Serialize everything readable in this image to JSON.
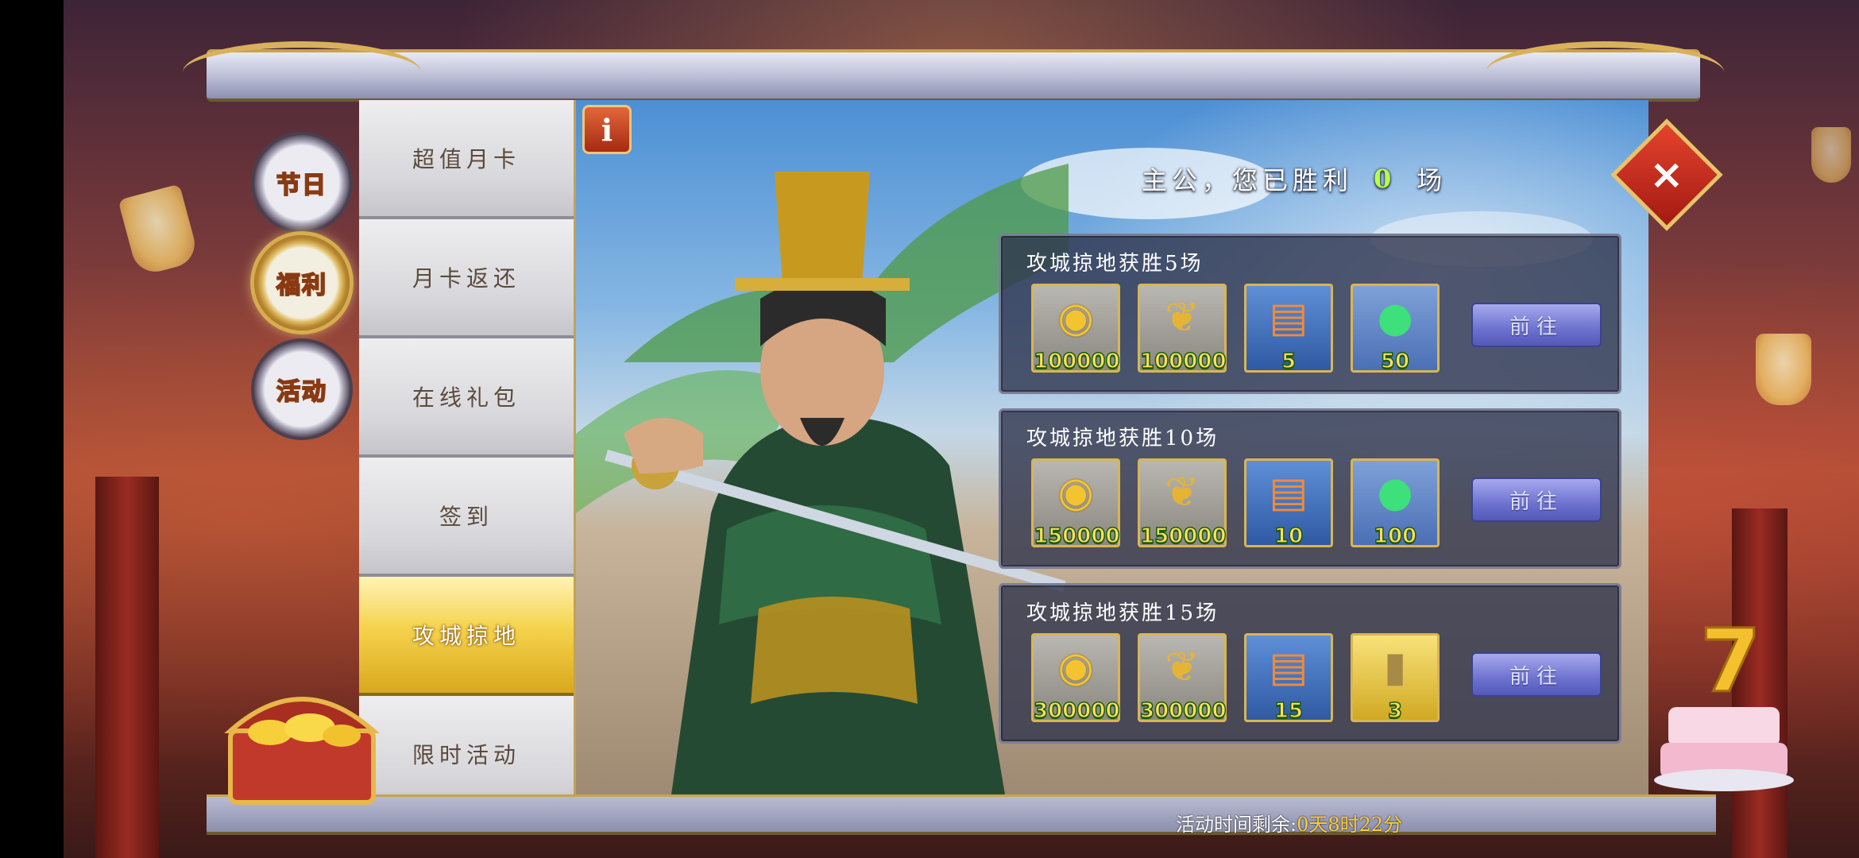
{
  "categories": [
    {
      "label": "节日",
      "active": false
    },
    {
      "label": "福利",
      "active": true
    },
    {
      "label": "活动",
      "active": false
    }
  ],
  "tabs": [
    {
      "label": "超值月卡"
    },
    {
      "label": "月卡返还"
    },
    {
      "label": "在线礼包"
    },
    {
      "label": "签到"
    },
    {
      "label": "攻城掠地"
    },
    {
      "label": "限时活动"
    }
  ],
  "active_tab": "攻城掠地",
  "info_button": "i",
  "wins": {
    "prefix": "主公，您已胜利",
    "count": "0",
    "suffix": "场"
  },
  "reward_tiers": [
    {
      "title": "攻城掠地获胜5场",
      "items": [
        {
          "icon": "coin-icon",
          "qty": "100000"
        },
        {
          "icon": "grain-icon",
          "qty": "100000"
        },
        {
          "icon": "scroll-icon",
          "qty": "5"
        },
        {
          "icon": "jade-gem-icon",
          "qty": "50"
        }
      ],
      "button": "前往"
    },
    {
      "title": "攻城掠地获胜10场",
      "items": [
        {
          "icon": "coin-icon",
          "qty": "150000"
        },
        {
          "icon": "grain-icon",
          "qty": "150000"
        },
        {
          "icon": "scroll-icon",
          "qty": "10"
        },
        {
          "icon": "jade-gem-icon",
          "qty": "100"
        }
      ],
      "button": "前往"
    },
    {
      "title": "攻城掠地获胜15场",
      "items": [
        {
          "icon": "coin-icon",
          "qty": "300000"
        },
        {
          "icon": "grain-icon",
          "qty": "300000"
        },
        {
          "icon": "scroll-icon",
          "qty": "15"
        },
        {
          "icon": "golden-token-icon",
          "qty": "3"
        }
      ],
      "button": "前往"
    }
  ],
  "footer": {
    "label": "活动时间剩余:",
    "remaining": "0天8时22分"
  },
  "close_icon": "×"
}
